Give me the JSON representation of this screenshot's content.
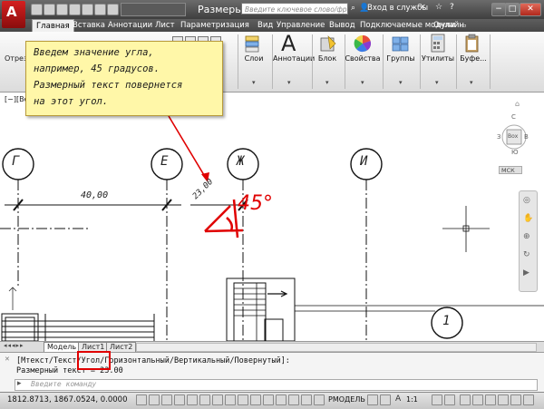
{
  "app": {
    "title": "Размеры.dwg",
    "search_placeholder": "Введите ключевое слово/фразу",
    "sign_in": "Вход в службы"
  },
  "tabs": [
    "Главная",
    "Вставка",
    "Аннотации",
    "Лист",
    "Параметризация",
    "Вид",
    "Управление",
    "Вывод",
    "Подключаемые модули",
    "Онлайн"
  ],
  "ribbon": {
    "left_label": "Отрез",
    "panels": [
      "Слои",
      "Аннотации",
      "Блок",
      "Свойства",
      "Группы",
      "Утилиты",
      "Буфе..."
    ]
  },
  "viewport_label": "[−][Ве",
  "callout": {
    "lines": [
      "Введем значение угла,",
      "например, 45 градусов.",
      "Размерный текст повернется",
      "на этот угол."
    ]
  },
  "drawing": {
    "axis_labels": [
      "Г",
      "Е",
      "Ж",
      "И",
      "1"
    ],
    "dim_main": "40,00",
    "dim_rotated": "23,00",
    "annotation": "45°",
    "viewcube_top": "С",
    "viewcube_face": "Вох",
    "viewcube_left": "З",
    "viewcube_right": "В",
    "viewcube_bottom": "Ю",
    "wcs": "МСК"
  },
  "layout_tabs": [
    "Модель",
    "Лист1",
    "Лист2"
  ],
  "command": {
    "line1": "[Мтекст/Текст/Угол/Горизонтальный/Вертикальный/Повернутый]:",
    "line2": "Размерный текст = 23.00",
    "placeholder": "Введите команду"
  },
  "status": {
    "coords": "1812.8713, 1867.0524, 0.0000",
    "mode": "РМОДЕЛЬ",
    "scale": "1:1"
  },
  "colors": {
    "callout_bg": "#fff7a8",
    "highlight": "#e00000",
    "annotation_red": "#e00000",
    "title_bar": "#4a4a4a"
  }
}
